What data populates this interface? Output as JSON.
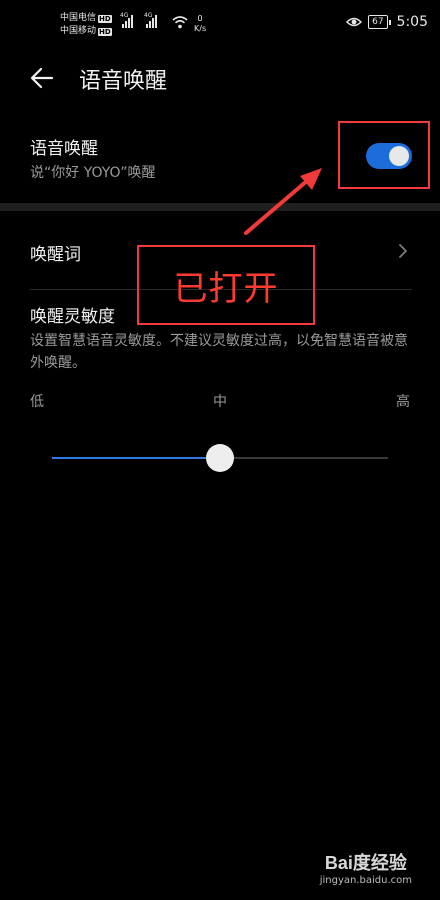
{
  "status_bar": {
    "carrier1": "中国电信",
    "carrier2": "中国移动",
    "hd": "HD",
    "net_type": "4G",
    "speed_value": "0",
    "speed_unit": "K/s",
    "battery": "67",
    "time": "5:05"
  },
  "header": {
    "title": "语音唤醒"
  },
  "voice_wakeup": {
    "title": "语音唤醒",
    "subtitle": "说“你好 YOYO”唤醒",
    "enabled": true
  },
  "wake_word": {
    "label": "唤醒词"
  },
  "sensitivity": {
    "title": "唤醒灵敏度",
    "description": "设置智慧语音灵敏度。不建议灵敏度过高，以免智慧语音被意外唤醒。",
    "low": "低",
    "mid": "中",
    "high": "高",
    "value_percent": 50
  },
  "annotation": {
    "text": "已打开",
    "color": "#ff3b30"
  },
  "watermark": {
    "logo": "Bai度经验",
    "url": "jingyan.baidu.com"
  },
  "colors": {
    "accent": "#1a6ddb",
    "background": "#000000"
  }
}
